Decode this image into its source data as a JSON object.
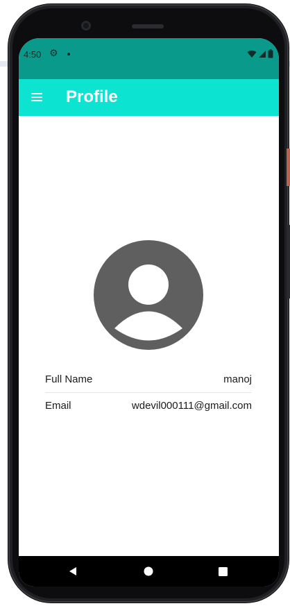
{
  "status_bar": {
    "time": "4:50",
    "icons": [
      "gear-icon",
      "notification-dot",
      "wifi-icon",
      "signal-icon",
      "battery-icon"
    ]
  },
  "app_bar": {
    "title": "Profile",
    "menu_icon": "hamburger-menu-icon",
    "color": "#0ce4d1"
  },
  "profile": {
    "avatar_icon": "account-circle-icon",
    "fields": [
      {
        "label": "Full Name",
        "value": "manoj"
      },
      {
        "label": "Email",
        "value": "wdevil000111@gmail.com"
      }
    ]
  },
  "nav_bar": {
    "buttons": [
      "back-icon",
      "home-icon",
      "recents-icon"
    ]
  },
  "colors": {
    "status_bar": "#0a9a8b",
    "app_bar": "#0ce4d1",
    "avatar": "#5f5f5f"
  }
}
